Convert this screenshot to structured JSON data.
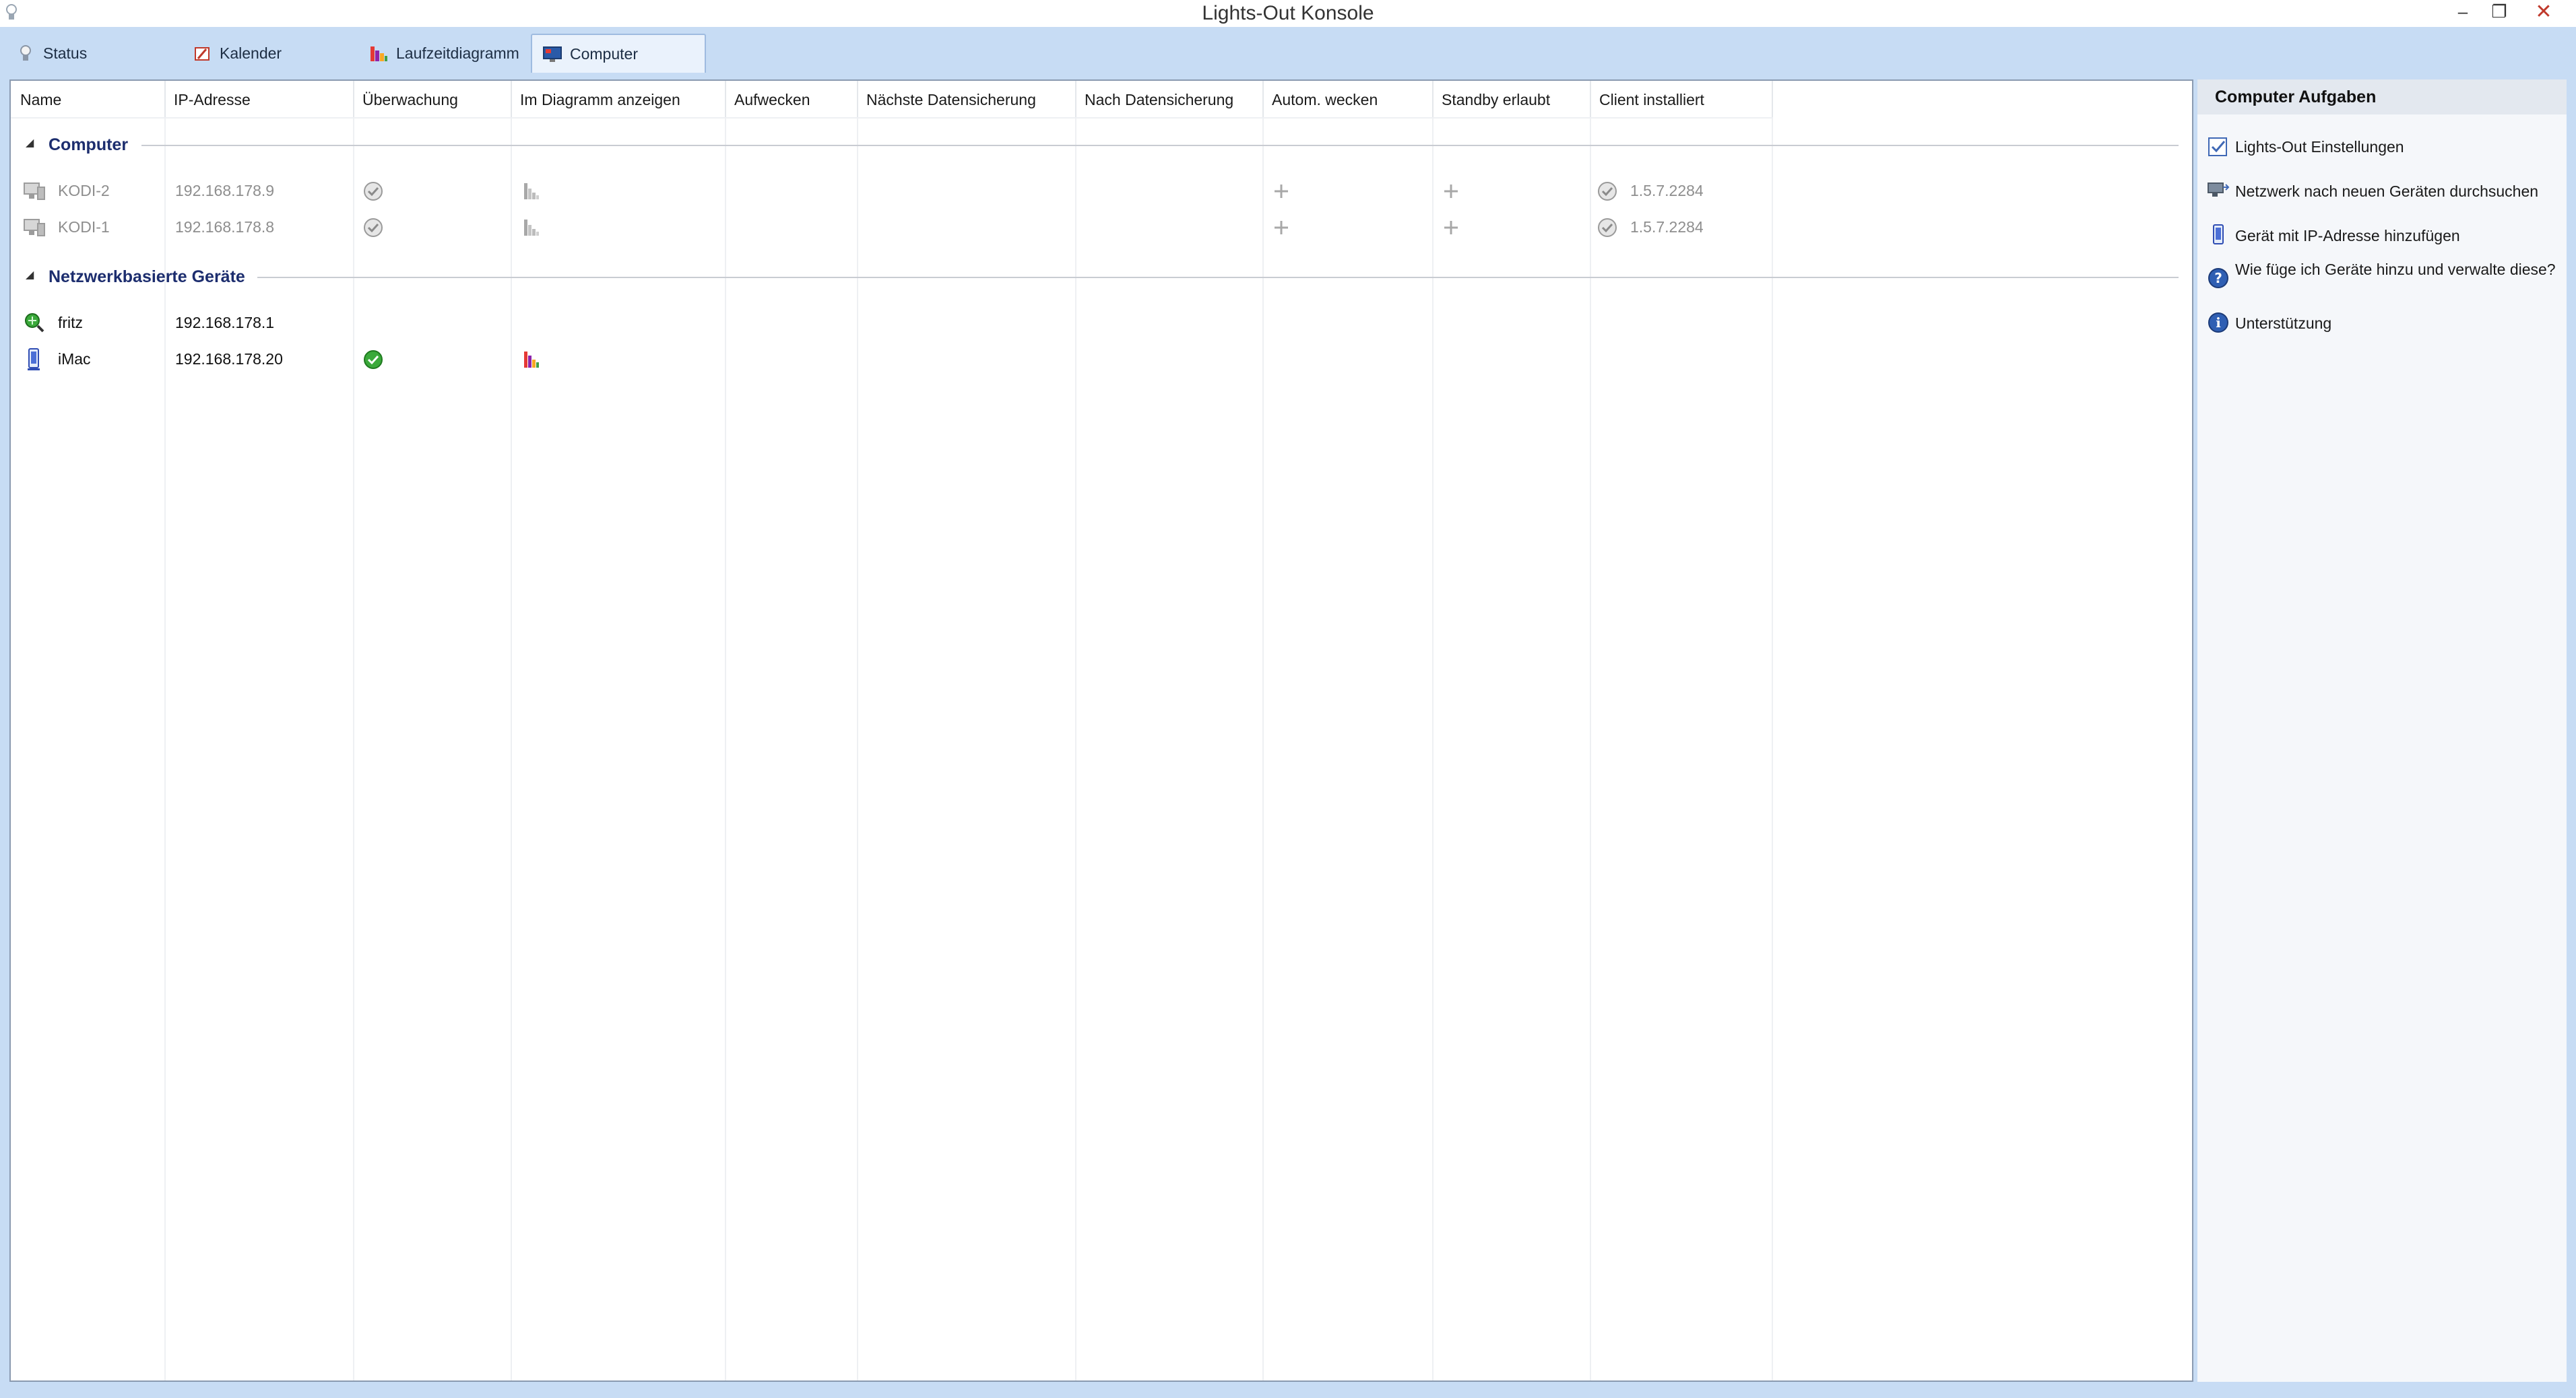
{
  "window": {
    "title": "Lights-Out Konsole",
    "app_icon": "bulb-icon",
    "controls": {
      "minimize": "–",
      "maximize": "❐",
      "close": "✕"
    }
  },
  "tabs": [
    {
      "label": "Status",
      "icon": "bulb-icon",
      "active": false
    },
    {
      "label": "Kalender",
      "icon": "calendar-icon",
      "active": false
    },
    {
      "label": "Laufzeitdiagramm",
      "icon": "bar-chart-icon",
      "active": false
    },
    {
      "label": "Computer",
      "icon": "computer-icon",
      "active": true
    }
  ],
  "grid": {
    "columns": [
      "Name",
      "IP-Adresse",
      "Überwachung",
      "Im Diagramm anzeigen",
      "Aufwecken",
      "Nächste Datensicherung",
      "Nach Datensicherung",
      "Autom. wecken",
      "Standby erlaubt",
      "Client installiert"
    ],
    "groups": [
      {
        "title": "Computer",
        "collapse_glyph": "◢",
        "rows": [
          {
            "name": "KODI-2",
            "ip": "192.168.178.9",
            "monitoring": "check-grey",
            "diagram": "chart-grey",
            "auto_wake": "plus",
            "standby": "plus",
            "client": "1.5.7.2284",
            "enabled": false
          },
          {
            "name": "KODI-1",
            "ip": "192.168.178.8",
            "monitoring": "check-grey",
            "diagram": "chart-grey",
            "auto_wake": "plus",
            "standby": "plus",
            "client": "1.5.7.2284",
            "enabled": false
          }
        ]
      },
      {
        "title": "Netzwerkbasierte Geräte",
        "collapse_glyph": "◢",
        "rows": [
          {
            "name": "fritz",
            "ip": "192.168.178.1",
            "device_icon": "router-icon",
            "enabled": true
          },
          {
            "name": "iMac",
            "ip": "192.168.178.20",
            "device_icon": "imac-icon",
            "monitoring": "check-green",
            "diagram": "chart-color",
            "enabled": true
          }
        ]
      }
    ]
  },
  "taskpane": {
    "title": "Computer Aufgaben",
    "items": [
      {
        "label": "Lights-Out Einstellungen",
        "icon": "settings-checkbox-icon"
      },
      {
        "label": "Netzwerk nach neuen Geräten durchsuchen",
        "icon": "network-scan-icon"
      },
      {
        "label": "Gerät mit IP-Adresse hinzufügen",
        "icon": "add-device-icon"
      },
      {
        "label": "Wie füge ich Geräte hinzu und verwalte diese?",
        "icon": "help-icon"
      },
      {
        "label": "Unterstützung",
        "icon": "info-icon"
      }
    ]
  },
  "colors": {
    "chrome": "#c7dcf4",
    "group_title": "#1c2d6e",
    "disabled_text": "#8e8e8e",
    "status_green": "#3aa93a"
  }
}
